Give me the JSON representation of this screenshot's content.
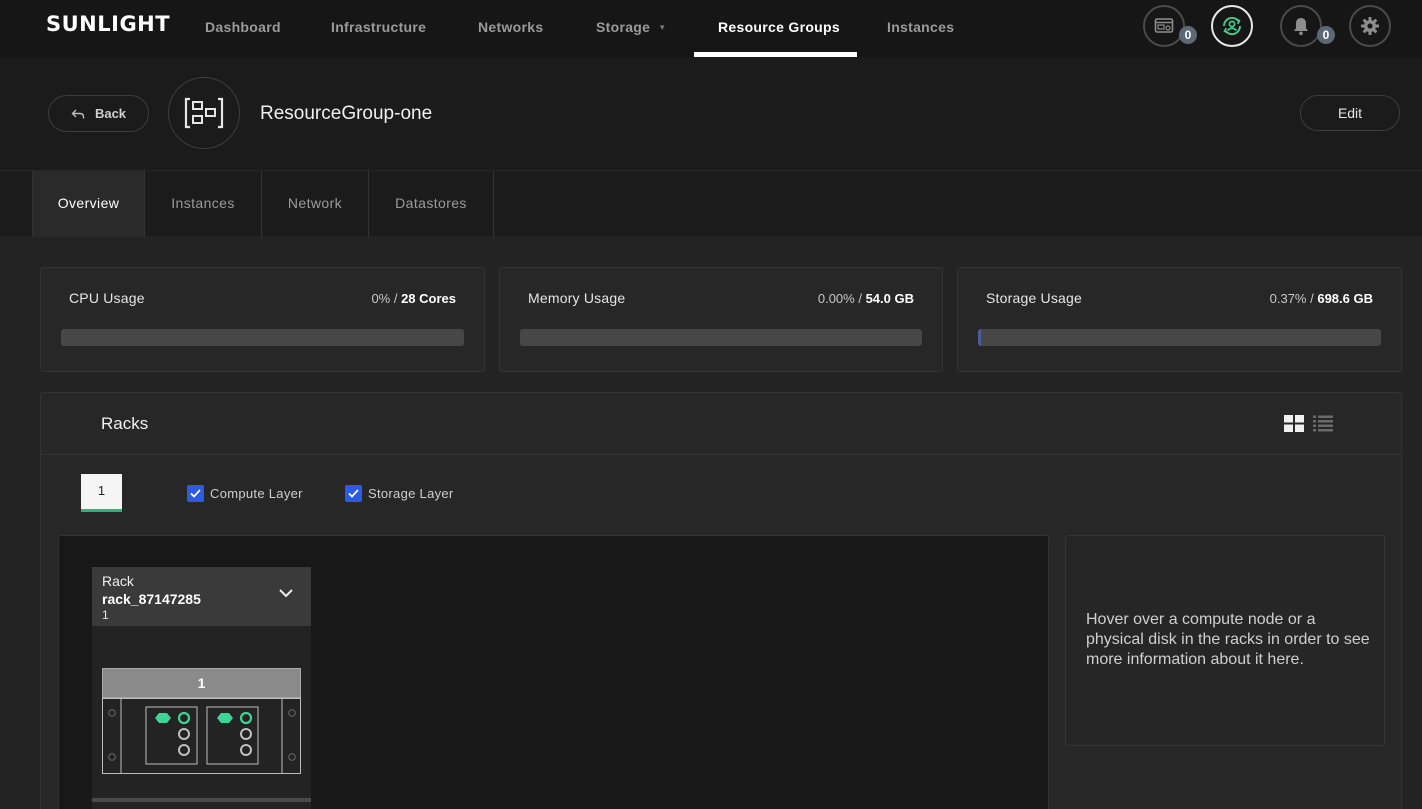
{
  "brand": {
    "logo_text": "SUNLIGHT"
  },
  "nav": {
    "items": [
      {
        "label": "Dashboard"
      },
      {
        "label": "Infrastructure"
      },
      {
        "label": "Networks"
      },
      {
        "label": "Storage",
        "has_dropdown": true
      },
      {
        "label": "Resource Groups",
        "active": true
      },
      {
        "label": "Instances"
      }
    ],
    "console_count": "0",
    "notification_count": "0",
    "icons": [
      "console-icon",
      "user-sync-icon",
      "bell-icon",
      "gear-icon"
    ]
  },
  "header": {
    "back_label": "Back",
    "title": "ResourceGroup-one",
    "edit_label": "Edit",
    "avatar_icon": "resource-group-icon"
  },
  "tabs": [
    {
      "label": "Overview",
      "active": true
    },
    {
      "label": "Instances"
    },
    {
      "label": "Network"
    },
    {
      "label": "Datastores"
    }
  ],
  "usage": {
    "cpu": {
      "label": "CPU Usage",
      "percent": "0%",
      "separator": " / ",
      "total": "28 Cores",
      "fill_fraction": 0.0
    },
    "memory": {
      "label": "Memory Usage",
      "percent": "0.00%",
      "separator": " / ",
      "total": "54.0 GB",
      "fill_fraction": 0.0
    },
    "storage": {
      "label": "Storage Usage",
      "percent": "0.37%",
      "separator": " / ",
      "total": "698.6 GB",
      "fill_fraction": 0.0037
    }
  },
  "racks": {
    "title": "Racks",
    "view_icons": [
      "grid-view-icon",
      "list-view-icon"
    ],
    "page_chip": "1",
    "layers": [
      {
        "label": "Compute Layer",
        "checked": true
      },
      {
        "label": "Storage Layer",
        "checked": true
      }
    ],
    "rack": {
      "kind_label": "Rack",
      "name": "rack_87147285",
      "number": "1",
      "chassis_label": "1"
    },
    "info_text": "Hover over a compute node or a physical disk in the racks in order to see more information about it here."
  },
  "colors": {
    "accent_green": "#2fb37a",
    "node_green": "#3fd494",
    "checkbox_blue": "#2d5be3",
    "storage_fill": "#4a5c9c"
  }
}
